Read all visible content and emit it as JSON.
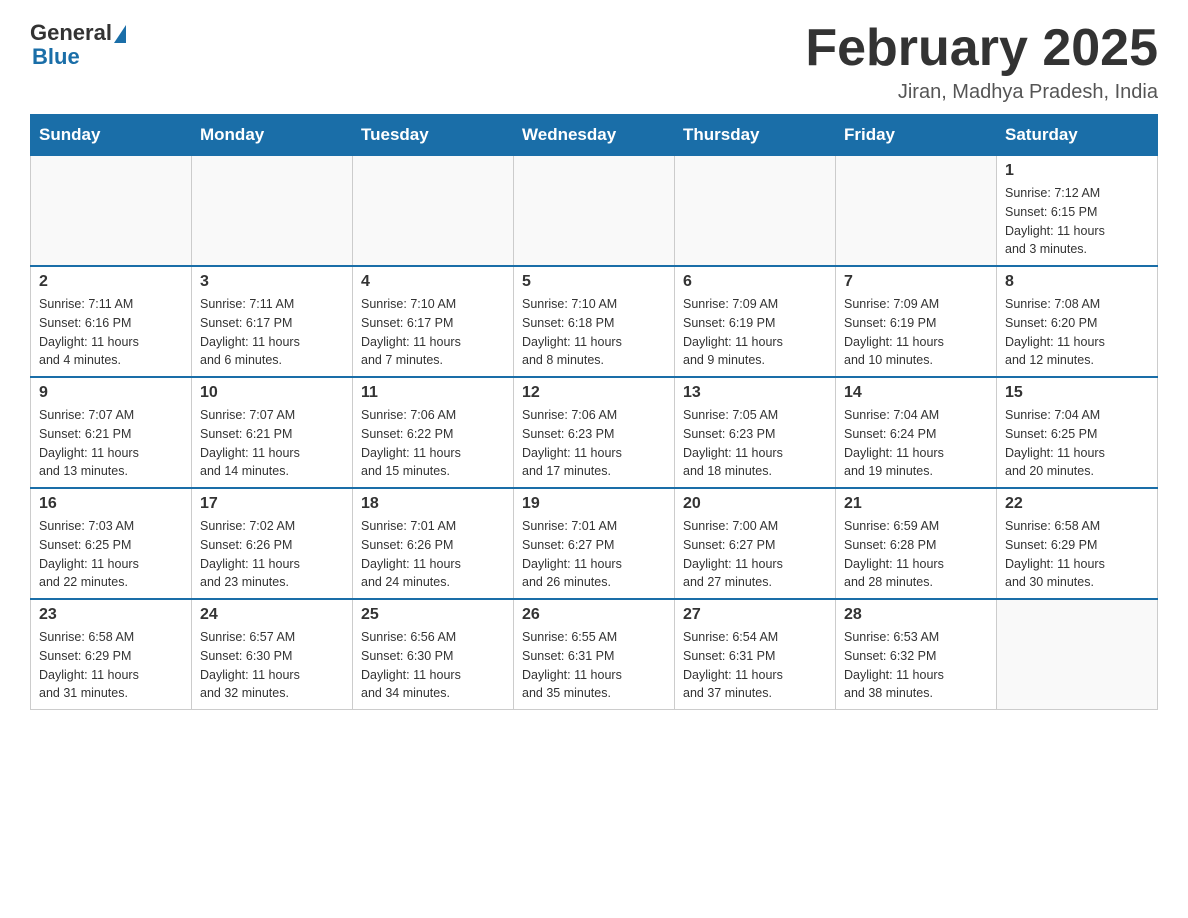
{
  "header": {
    "logo_general": "General",
    "logo_blue": "Blue",
    "month_title": "February 2025",
    "location": "Jiran, Madhya Pradesh, India"
  },
  "weekdays": [
    "Sunday",
    "Monday",
    "Tuesday",
    "Wednesday",
    "Thursday",
    "Friday",
    "Saturday"
  ],
  "weeks": [
    [
      {
        "day": "",
        "info": ""
      },
      {
        "day": "",
        "info": ""
      },
      {
        "day": "",
        "info": ""
      },
      {
        "day": "",
        "info": ""
      },
      {
        "day": "",
        "info": ""
      },
      {
        "day": "",
        "info": ""
      },
      {
        "day": "1",
        "info": "Sunrise: 7:12 AM\nSunset: 6:15 PM\nDaylight: 11 hours\nand 3 minutes."
      }
    ],
    [
      {
        "day": "2",
        "info": "Sunrise: 7:11 AM\nSunset: 6:16 PM\nDaylight: 11 hours\nand 4 minutes."
      },
      {
        "day": "3",
        "info": "Sunrise: 7:11 AM\nSunset: 6:17 PM\nDaylight: 11 hours\nand 6 minutes."
      },
      {
        "day": "4",
        "info": "Sunrise: 7:10 AM\nSunset: 6:17 PM\nDaylight: 11 hours\nand 7 minutes."
      },
      {
        "day": "5",
        "info": "Sunrise: 7:10 AM\nSunset: 6:18 PM\nDaylight: 11 hours\nand 8 minutes."
      },
      {
        "day": "6",
        "info": "Sunrise: 7:09 AM\nSunset: 6:19 PM\nDaylight: 11 hours\nand 9 minutes."
      },
      {
        "day": "7",
        "info": "Sunrise: 7:09 AM\nSunset: 6:19 PM\nDaylight: 11 hours\nand 10 minutes."
      },
      {
        "day": "8",
        "info": "Sunrise: 7:08 AM\nSunset: 6:20 PM\nDaylight: 11 hours\nand 12 minutes."
      }
    ],
    [
      {
        "day": "9",
        "info": "Sunrise: 7:07 AM\nSunset: 6:21 PM\nDaylight: 11 hours\nand 13 minutes."
      },
      {
        "day": "10",
        "info": "Sunrise: 7:07 AM\nSunset: 6:21 PM\nDaylight: 11 hours\nand 14 minutes."
      },
      {
        "day": "11",
        "info": "Sunrise: 7:06 AM\nSunset: 6:22 PM\nDaylight: 11 hours\nand 15 minutes."
      },
      {
        "day": "12",
        "info": "Sunrise: 7:06 AM\nSunset: 6:23 PM\nDaylight: 11 hours\nand 17 minutes."
      },
      {
        "day": "13",
        "info": "Sunrise: 7:05 AM\nSunset: 6:23 PM\nDaylight: 11 hours\nand 18 minutes."
      },
      {
        "day": "14",
        "info": "Sunrise: 7:04 AM\nSunset: 6:24 PM\nDaylight: 11 hours\nand 19 minutes."
      },
      {
        "day": "15",
        "info": "Sunrise: 7:04 AM\nSunset: 6:25 PM\nDaylight: 11 hours\nand 20 minutes."
      }
    ],
    [
      {
        "day": "16",
        "info": "Sunrise: 7:03 AM\nSunset: 6:25 PM\nDaylight: 11 hours\nand 22 minutes."
      },
      {
        "day": "17",
        "info": "Sunrise: 7:02 AM\nSunset: 6:26 PM\nDaylight: 11 hours\nand 23 minutes."
      },
      {
        "day": "18",
        "info": "Sunrise: 7:01 AM\nSunset: 6:26 PM\nDaylight: 11 hours\nand 24 minutes."
      },
      {
        "day": "19",
        "info": "Sunrise: 7:01 AM\nSunset: 6:27 PM\nDaylight: 11 hours\nand 26 minutes."
      },
      {
        "day": "20",
        "info": "Sunrise: 7:00 AM\nSunset: 6:27 PM\nDaylight: 11 hours\nand 27 minutes."
      },
      {
        "day": "21",
        "info": "Sunrise: 6:59 AM\nSunset: 6:28 PM\nDaylight: 11 hours\nand 28 minutes."
      },
      {
        "day": "22",
        "info": "Sunrise: 6:58 AM\nSunset: 6:29 PM\nDaylight: 11 hours\nand 30 minutes."
      }
    ],
    [
      {
        "day": "23",
        "info": "Sunrise: 6:58 AM\nSunset: 6:29 PM\nDaylight: 11 hours\nand 31 minutes."
      },
      {
        "day": "24",
        "info": "Sunrise: 6:57 AM\nSunset: 6:30 PM\nDaylight: 11 hours\nand 32 minutes."
      },
      {
        "day": "25",
        "info": "Sunrise: 6:56 AM\nSunset: 6:30 PM\nDaylight: 11 hours\nand 34 minutes."
      },
      {
        "day": "26",
        "info": "Sunrise: 6:55 AM\nSunset: 6:31 PM\nDaylight: 11 hours\nand 35 minutes."
      },
      {
        "day": "27",
        "info": "Sunrise: 6:54 AM\nSunset: 6:31 PM\nDaylight: 11 hours\nand 37 minutes."
      },
      {
        "day": "28",
        "info": "Sunrise: 6:53 AM\nSunset: 6:32 PM\nDaylight: 11 hours\nand 38 minutes."
      },
      {
        "day": "",
        "info": ""
      }
    ]
  ]
}
